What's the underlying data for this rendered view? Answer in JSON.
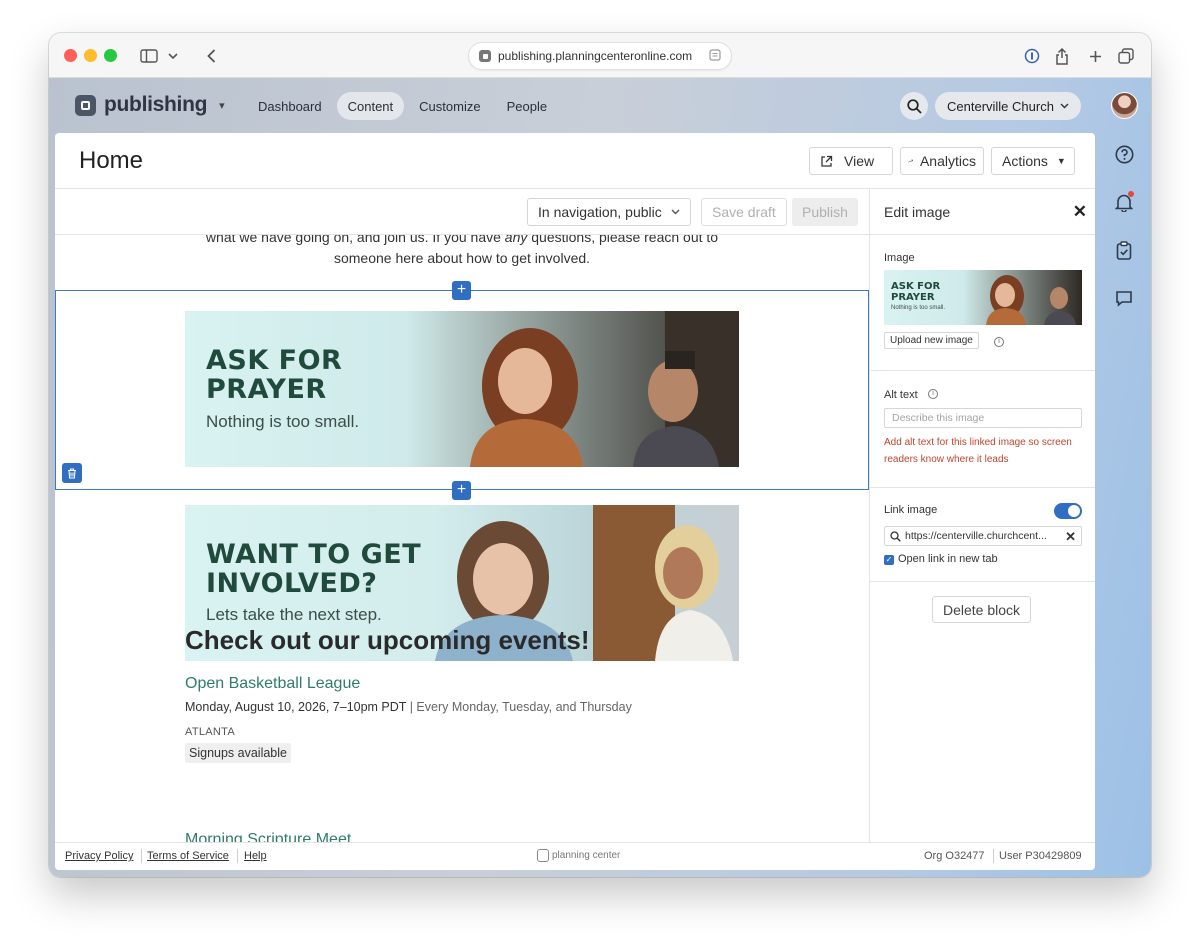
{
  "browser": {
    "url": "publishing.planningcenteronline.com"
  },
  "app": {
    "name": "publishing",
    "nav": [
      {
        "label": "Dashboard",
        "active": false
      },
      {
        "label": "Content",
        "active": true
      },
      {
        "label": "Customize",
        "active": false
      },
      {
        "label": "People",
        "active": false
      }
    ],
    "org_switcher": "Centerville Church"
  },
  "page": {
    "title": "Home",
    "view_label": "View",
    "analytics_label": "Analytics",
    "actions_label": "Actions"
  },
  "editor": {
    "visibility": "In navigation, public",
    "save_draft_label": "Save draft",
    "publish_label": "Publish",
    "intro_line1_pre": "what we have going on, and join us. If you have ",
    "intro_line1_em": "any",
    "intro_line1_post": " questions, please reach out to",
    "intro_line2": "someone here about how to get involved.",
    "banner1": {
      "title_line1": "ASK FOR",
      "title_line2": "PRAYER",
      "subtitle": "Nothing is too small."
    },
    "banner2": {
      "title_line1": "WANT TO GET",
      "title_line2": "INVOLVED?",
      "subtitle": "Lets take the next step."
    },
    "events_heading": "Check out our upcoming events!",
    "event": {
      "title": "Open Basketball League",
      "time": "Monday, August 10, 2026, 7–10pm PDT",
      "recurrence": "| Every Monday, Tuesday, and Thursday",
      "location": "ATLANTA",
      "tag": "Signups available"
    },
    "next_event_title": "Morning Scripture Meet"
  },
  "panel": {
    "title": "Edit image",
    "image_label": "Image",
    "thumb_title_line1": "ASK FOR",
    "thumb_title_line2": "PRAYER",
    "thumb_subtitle": "Nothing is too small.",
    "upload_label": "Upload new image",
    "alt_label": "Alt text",
    "alt_placeholder": "Describe this image",
    "alt_error": "Add alt text for this linked image so screen readers know where it leads",
    "link_label": "Link image",
    "link_enabled": true,
    "link_value": "https://centerville.churchcent...",
    "open_new_tab_label": "Open link in new tab",
    "open_new_tab_checked": true,
    "delete_label": "Delete block"
  },
  "footer": {
    "privacy": "Privacy Policy",
    "terms": "Terms of Service",
    "help": "Help",
    "brand": "planning center",
    "org": "Org O32477",
    "user": "User P30429809"
  },
  "colors": {
    "accent": "#2f6ec1",
    "event_title": "#2f7d68",
    "error": "#c0452f",
    "banner_bg": "#d9f2f2"
  }
}
